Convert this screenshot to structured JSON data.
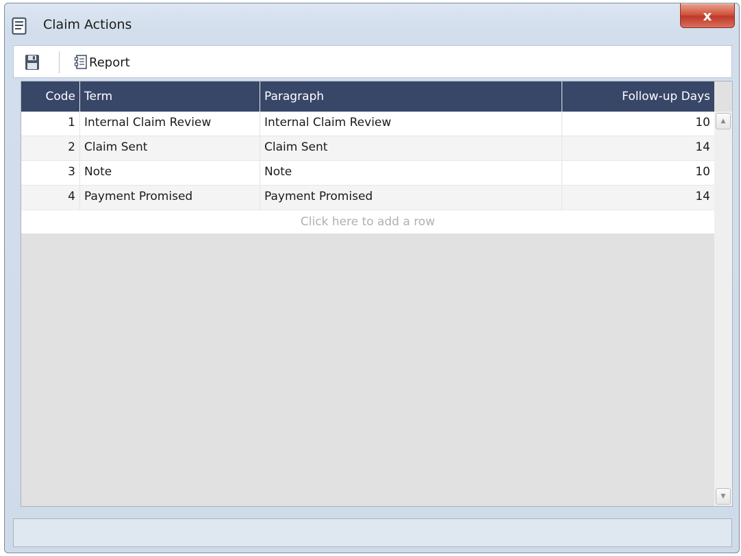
{
  "window": {
    "title": "Claim Actions",
    "close_label": "x"
  },
  "toolbar": {
    "report_label": "Report"
  },
  "grid": {
    "columns": [
      "Code",
      "Term",
      "Paragraph",
      "Follow-up Days"
    ],
    "rows": [
      {
        "code": "1",
        "term": "Internal Claim Review",
        "paragraph": "Internal Claim Review",
        "days": "10"
      },
      {
        "code": "2",
        "term": "Claim Sent",
        "paragraph": "Claim Sent",
        "days": "14"
      },
      {
        "code": "3",
        "term": "Note",
        "paragraph": "Note",
        "days": "10"
      },
      {
        "code": "4",
        "term": "Payment Promised",
        "paragraph": "Payment Promised",
        "days": "14"
      }
    ],
    "add_row_text": "Click here to add a row"
  },
  "icons": {
    "title": "list-window-icon",
    "close": "close-icon",
    "save": "floppy-disk-icon",
    "report": "report-icon",
    "scroll_up": "arrow-up-icon",
    "scroll_down": "arrow-down-icon"
  },
  "colors": {
    "header_bg": "#384768",
    "close_button": "#c0392b",
    "window_frame": "#d2deec"
  }
}
